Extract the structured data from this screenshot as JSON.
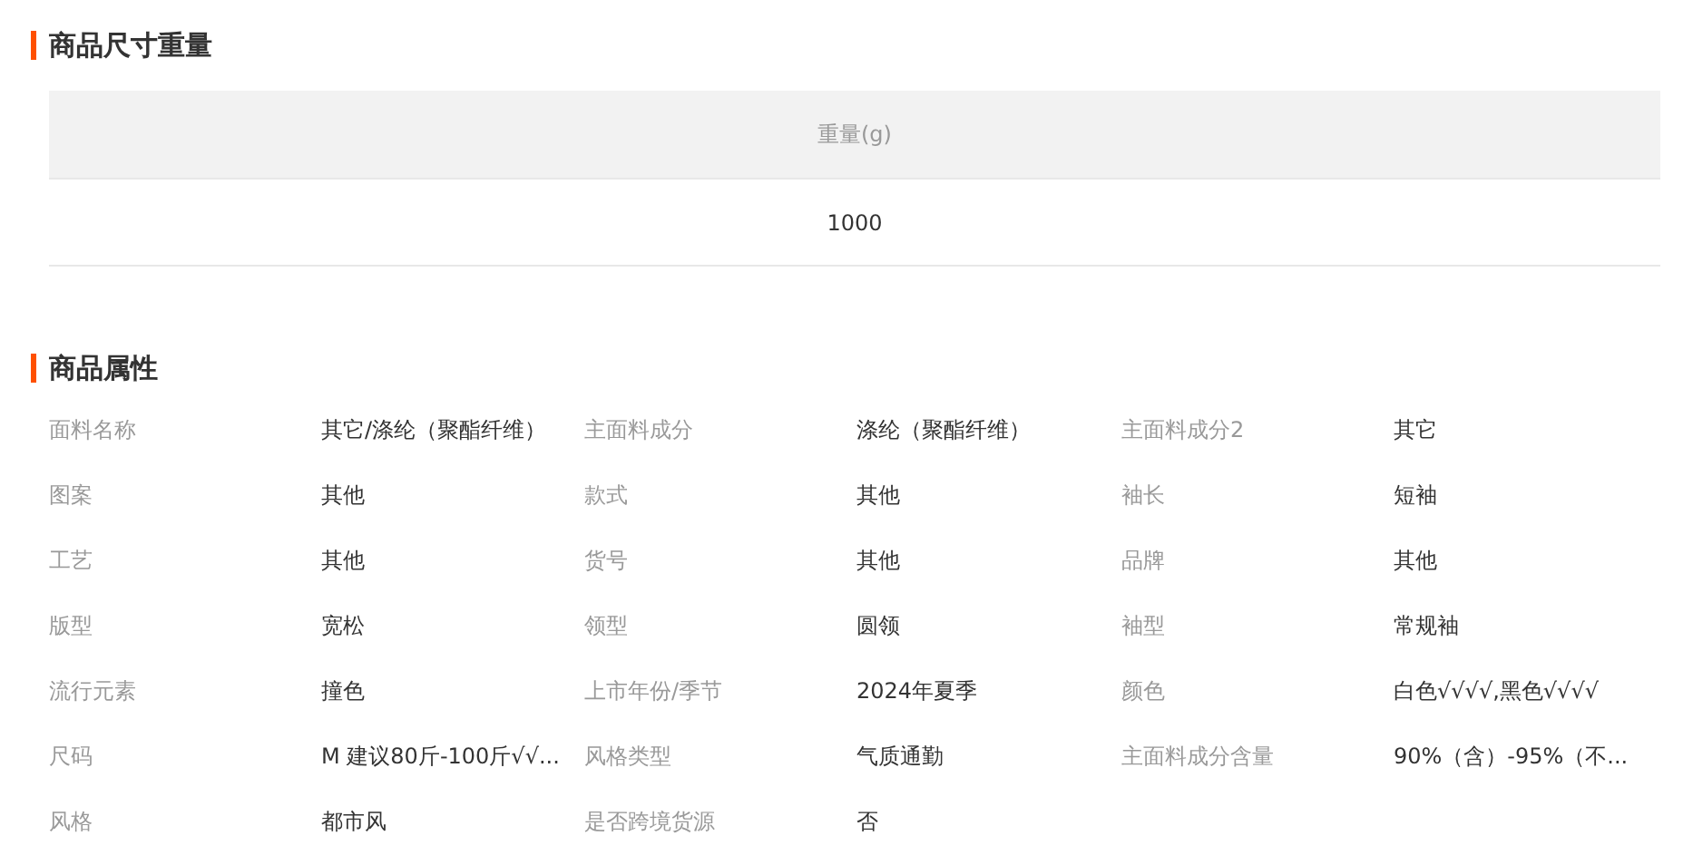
{
  "size_weight": {
    "title": "商品尺寸重量",
    "columns": [
      "重量(g)"
    ],
    "rows": [
      [
        "1000"
      ]
    ]
  },
  "attributes": {
    "title": "商品属性",
    "items": [
      {
        "label": "面料名称",
        "value": "其它/涤纶（聚酯纤维）"
      },
      {
        "label": "主面料成分",
        "value": "涤纶（聚酯纤维）"
      },
      {
        "label": "主面料成分2",
        "value": "其它"
      },
      {
        "label": "图案",
        "value": "其他"
      },
      {
        "label": "款式",
        "value": "其他"
      },
      {
        "label": "袖长",
        "value": "短袖"
      },
      {
        "label": "工艺",
        "value": "其他"
      },
      {
        "label": "货号",
        "value": "其他"
      },
      {
        "label": "品牌",
        "value": "其他"
      },
      {
        "label": "版型",
        "value": "宽松"
      },
      {
        "label": "领型",
        "value": "圆领"
      },
      {
        "label": "袖型",
        "value": "常规袖"
      },
      {
        "label": "流行元素",
        "value": "撞色"
      },
      {
        "label": "上市年份/季节",
        "value": "2024年夏季"
      },
      {
        "label": "颜色",
        "value": "白色√√√√,黑色√√√√"
      },
      {
        "label": "尺码",
        "value": "M 建议80斤-100斤√√..."
      },
      {
        "label": "风格类型",
        "value": "气质通勤"
      },
      {
        "label": "主面料成分含量",
        "value": "90%（含）-95%（不..."
      },
      {
        "label": "风格",
        "value": "都市风"
      },
      {
        "label": "是否跨境货源",
        "value": "否"
      }
    ]
  }
}
